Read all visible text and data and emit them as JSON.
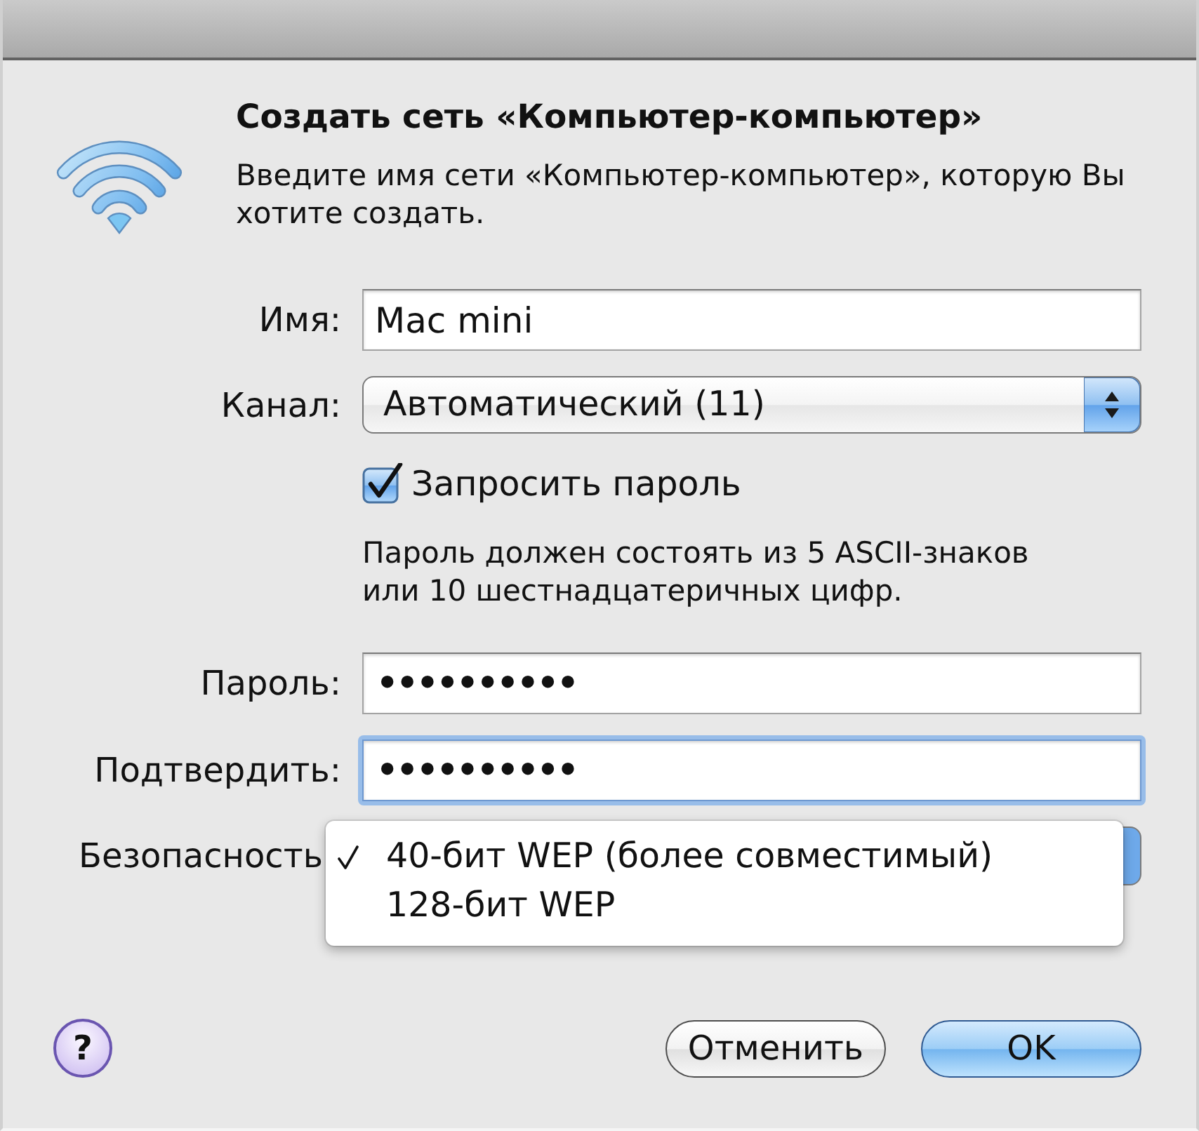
{
  "dialog": {
    "title": "Создать сеть «Компьютер-компьютер»",
    "description": "Введите имя сети «Компьютер-компьютер», которую Вы хотите создать."
  },
  "rows": [
    {
      "kind": "text",
      "label": "Имя:",
      "value": "Mac mini",
      "focused": false
    },
    {
      "kind": "popup",
      "label": "Канал:",
      "value": "Автоматический (11)"
    },
    {
      "kind": "checkbox",
      "label": "Запросить пароль",
      "checked": true
    },
    {
      "kind": "note",
      "text": "Пароль должен состоять из 5 ASCII-знаков или 10 шестнадцатеричных цифр."
    },
    {
      "kind": "password",
      "label": "Пароль:",
      "value": "••••••••••",
      "focused": false
    },
    {
      "kind": "password",
      "label": "Подтвердить:",
      "value": "••••••••••",
      "focused": true
    },
    {
      "kind": "menu",
      "label": "Безопасность",
      "options": [
        {
          "label": "40-бит WEP (более совместимый)",
          "selected": true
        },
        {
          "label": "128-бит WEP",
          "selected": false
        }
      ]
    }
  ],
  "help_button": {
    "label": "?"
  },
  "buttons": [
    {
      "label": "Отменить",
      "kind": "cancel"
    },
    {
      "label": "OK",
      "kind": "default"
    }
  ]
}
